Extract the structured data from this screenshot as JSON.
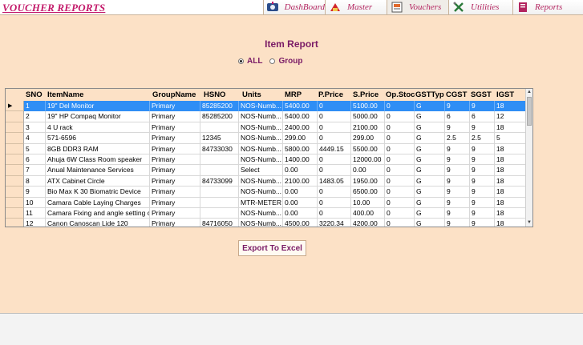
{
  "app": {
    "title": "VOUCHER REPORTS"
  },
  "nav": [
    {
      "label": "DashBoard",
      "icon": "dashboard-icon"
    },
    {
      "label": "Master",
      "icon": "master-icon"
    },
    {
      "label": "Vouchers",
      "icon": "vouchers-icon"
    },
    {
      "label": "Utilities",
      "icon": "utilities-icon"
    },
    {
      "label": "Reports",
      "icon": "reports-icon"
    }
  ],
  "report": {
    "title": "Item Report",
    "filter": {
      "options": [
        "ALL",
        "Group"
      ],
      "selected": "ALL"
    }
  },
  "table": {
    "columns": [
      "SNO",
      "ItemName",
      "GroupName",
      "HSNO",
      "Units",
      "MRP",
      "P.Price",
      "S.Price",
      "Op.Stoc",
      "GSTTyp",
      "CGST",
      "SGST",
      "IGST"
    ],
    "selected_row": 0,
    "rows": [
      [
        "1",
        "19\" Del Monitor",
        "Primary",
        "85285200",
        "NOS-Numb...",
        "5400.00",
        "0",
        "5100.00",
        "0",
        "G",
        "9",
        "9",
        "18"
      ],
      [
        "2",
        "19\" HP Compaq Monitor",
        "Primary",
        "85285200",
        "NOS-Numb...",
        "5400.00",
        "0",
        "5000.00",
        "0",
        "G",
        "6",
        "6",
        "12"
      ],
      [
        "3",
        "4 U rack",
        "Primary",
        "",
        "NOS-Numb...",
        "2400.00",
        "0",
        "2100.00",
        "0",
        "G",
        "9",
        "9",
        "18"
      ],
      [
        "4",
        "571-6596",
        "Primary",
        "12345",
        "NOS-Numb...",
        "299.00",
        "0",
        "299.00",
        "0",
        "G",
        "2.5",
        "2.5",
        "5"
      ],
      [
        "5",
        "8GB DDR3 RAM",
        "Primary",
        "84733030",
        "NOS-Numb...",
        "5800.00",
        "4449.15",
        "5500.00",
        "0",
        "G",
        "9",
        "9",
        "18"
      ],
      [
        "6",
        "Ahuja 6W Class Room speaker",
        "Primary",
        "",
        "NOS-Numb...",
        "1400.00",
        "0",
        "12000.00",
        "0",
        "G",
        "9",
        "9",
        "18"
      ],
      [
        "7",
        "Anual Maintenance Services",
        "Primary",
        "",
        "Select",
        "0.00",
        "0",
        "0.00",
        "0",
        "G",
        "9",
        "9",
        "18"
      ],
      [
        "8",
        "ATX Cabinet Circle",
        "Primary",
        "84733099",
        "NOS-Numb...",
        "2100.00",
        "1483.05",
        "1950.00",
        "0",
        "G",
        "9",
        "9",
        "18"
      ],
      [
        "9",
        "Bio Max K 30 Biomatric Device",
        "Primary",
        "",
        "NOS-Numb...",
        "0.00",
        "0",
        "6500.00",
        "0",
        "G",
        "9",
        "9",
        "18"
      ],
      [
        "10",
        "Camara Cable Laying Charges",
        "Primary",
        "",
        "MTR-METER",
        "0.00",
        "0",
        "10.00",
        "0",
        "G",
        "9",
        "9",
        "18"
      ],
      [
        "11",
        "Camara Fixing and angle setting ch...",
        "Primary",
        "",
        "NOS-Numb...",
        "0.00",
        "0",
        "400.00",
        "0",
        "G",
        "9",
        "9",
        "18"
      ],
      [
        "12",
        "Canon Canoscan Lide 120",
        "Primary",
        "84716050",
        "NOS-Numb...",
        "4500.00",
        "3220.34",
        "4200.00",
        "0",
        "G",
        "9",
        "9",
        "18"
      ]
    ]
  },
  "actions": {
    "export_label": "Export To Excel"
  }
}
